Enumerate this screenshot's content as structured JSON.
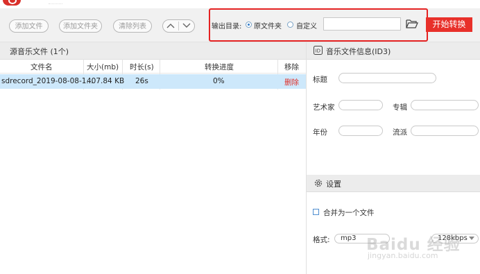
{
  "toolbar": {
    "add_file": "添加文件",
    "add_folder": "添加文件夹",
    "clear_list": "清除列表",
    "output_label": "输出目录:",
    "option_original": "原文件夹",
    "option_custom": "自定义",
    "output_path": "",
    "start_button": "开始转换"
  },
  "source": {
    "title": "源音乐文件 (1个)",
    "columns": [
      "文件名",
      "大小(mb)",
      "时长(s)",
      "转换进度",
      "移除"
    ],
    "rows": [
      {
        "name": "sdrecord_2019-08-08-1...",
        "size": "407.84 KB",
        "duration": "26s",
        "progress": "0%",
        "remove": "删除"
      }
    ]
  },
  "info": {
    "title": "音乐文件信息(ID3)",
    "title_label": "标题",
    "artist_label": "艺术家",
    "album_label": "专辑",
    "year_label": "年份",
    "genre_label": "流派"
  },
  "settings": {
    "title": "设置",
    "merge_label": "合并为一个文件",
    "format_label": "格式:",
    "format_value": "mp3",
    "bitrate_value": "128kbps"
  },
  "watermark": {
    "main": "Baidu 经验",
    "sub": "jingyan.baidu.com"
  },
  "icons": [
    "app-logo-icon",
    "up-arrow-icon",
    "down-arrow-icon",
    "folder-open-icon",
    "id3-icon",
    "gear-icon",
    "checkbox-icon"
  ],
  "colors": {
    "accent": "#e8302a",
    "selected_row": "#cde8fb",
    "radio": "#2e79c8"
  }
}
